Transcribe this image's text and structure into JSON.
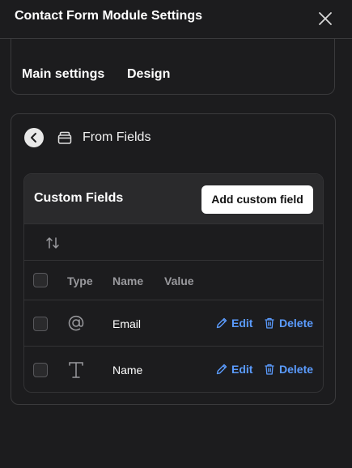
{
  "header": {
    "title": "Contact Form Module Settings"
  },
  "tabs": [
    {
      "label": "Main settings"
    },
    {
      "label": "Design"
    }
  ],
  "section": {
    "title": "From Fields"
  },
  "custom_fields": {
    "title": "Custom Fields",
    "add_button": "Add custom field",
    "columns": {
      "type": "Type",
      "name": "Name",
      "value": "Value"
    },
    "rows": [
      {
        "type_icon": "at-sign-icon",
        "name": "Email",
        "edit": "Edit",
        "delete": "Delete"
      },
      {
        "type_icon": "text-t-icon",
        "name": "Name",
        "edit": "Edit",
        "delete": "Delete"
      }
    ]
  },
  "colors": {
    "background": "#1c1c1e",
    "link": "#5b9cff",
    "border": "#3a3a3c"
  }
}
